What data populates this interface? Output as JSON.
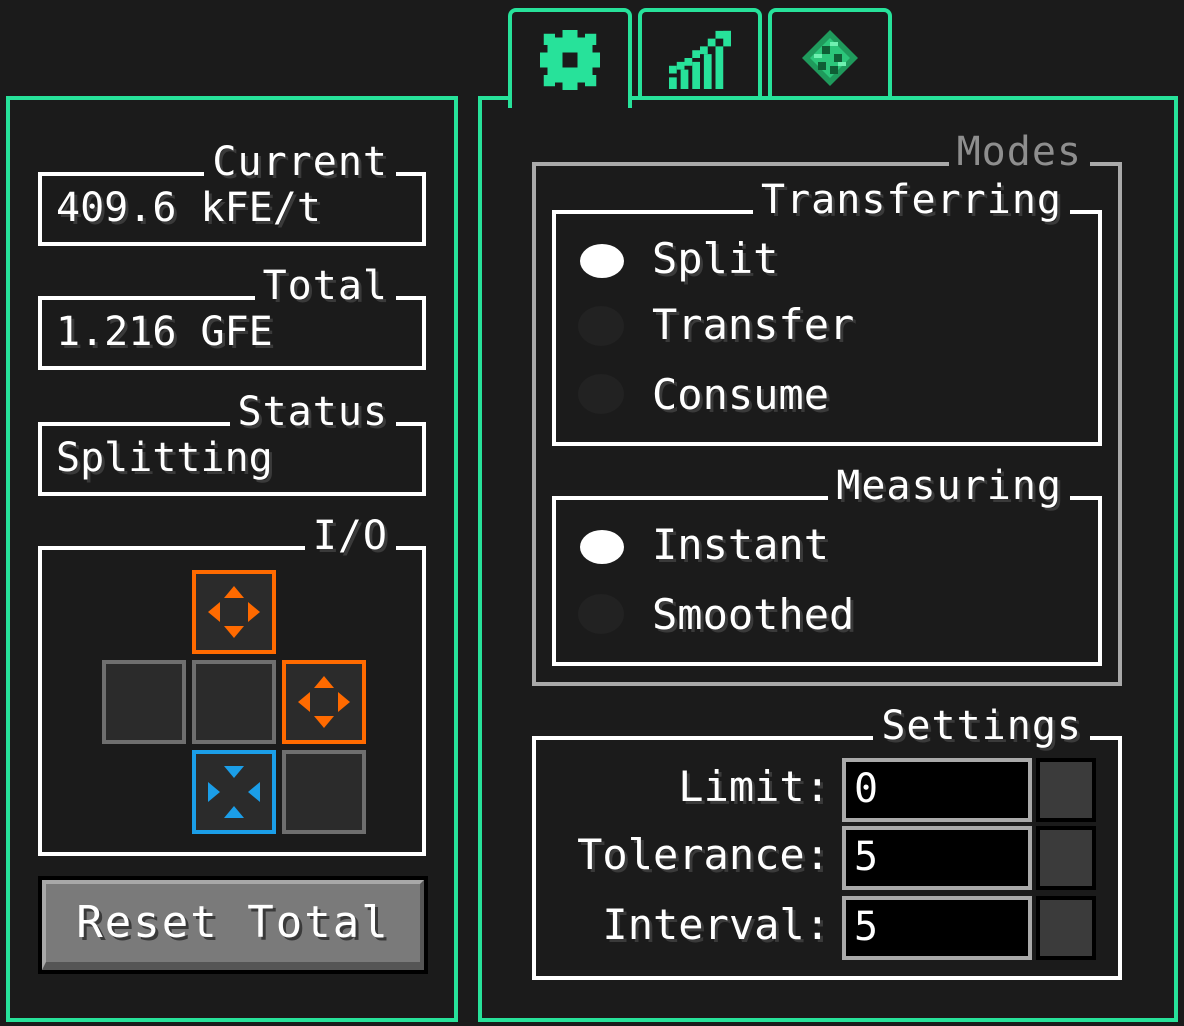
{
  "tabs": [
    {
      "icon": "gear-icon",
      "active": true
    },
    {
      "icon": "chart-icon",
      "active": false
    },
    {
      "icon": "gem-icon",
      "active": false
    }
  ],
  "left": {
    "current": {
      "label": "Current",
      "value": "409.6 kFE/t"
    },
    "total": {
      "label": "Total",
      "value": "1.216 GFE"
    },
    "status": {
      "label": "Status",
      "value": "Splitting"
    },
    "io": {
      "label": "I/O"
    },
    "reset_button": "Reset Total"
  },
  "right": {
    "modes_label": "Modes",
    "transferring": {
      "label": "Transferring",
      "options": [
        {
          "label": "Split",
          "selected": true
        },
        {
          "label": "Transfer",
          "selected": false
        },
        {
          "label": "Consume",
          "selected": false
        }
      ]
    },
    "measuring": {
      "label": "Measuring",
      "options": [
        {
          "label": "Instant",
          "selected": true
        },
        {
          "label": "Smoothed",
          "selected": false
        }
      ]
    },
    "settings": {
      "label": "Settings",
      "rows": [
        {
          "label": "Limit:",
          "value": "0"
        },
        {
          "label": "Tolerance:",
          "value": "5"
        },
        {
          "label": "Interval:",
          "value": "5"
        }
      ]
    }
  },
  "colors": {
    "accent": "#27e29a",
    "output": "#ff6a00",
    "input": "#1b9ee8"
  }
}
